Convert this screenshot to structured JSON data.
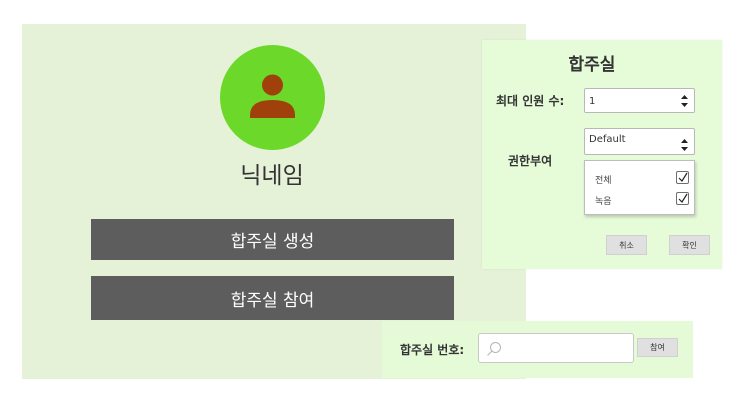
{
  "profile": {
    "nickname": "닉네임",
    "avatar_color": "#6cd82a",
    "avatar_figure_color": "#a0410c"
  },
  "actions": {
    "create_room_label": "합주실 생성",
    "join_room_label": "합주실 참여"
  },
  "settings": {
    "title": "합주실",
    "max_members_label": "최대 인원 수:",
    "max_members_value": "1",
    "permission_label": "권한부여",
    "permission_select_value": "Default",
    "permission_options": [
      {
        "label": "전체",
        "checked": true
      },
      {
        "label": "녹음",
        "checked": true
      }
    ],
    "cancel_label": "취소",
    "confirm_label": "확인"
  },
  "join": {
    "room_number_label": "합주실 번호:",
    "room_number_value": "",
    "join_label": "참여"
  },
  "icons": [
    "user-icon",
    "spinner-arrows-icon",
    "check-icon",
    "search-icon"
  ]
}
